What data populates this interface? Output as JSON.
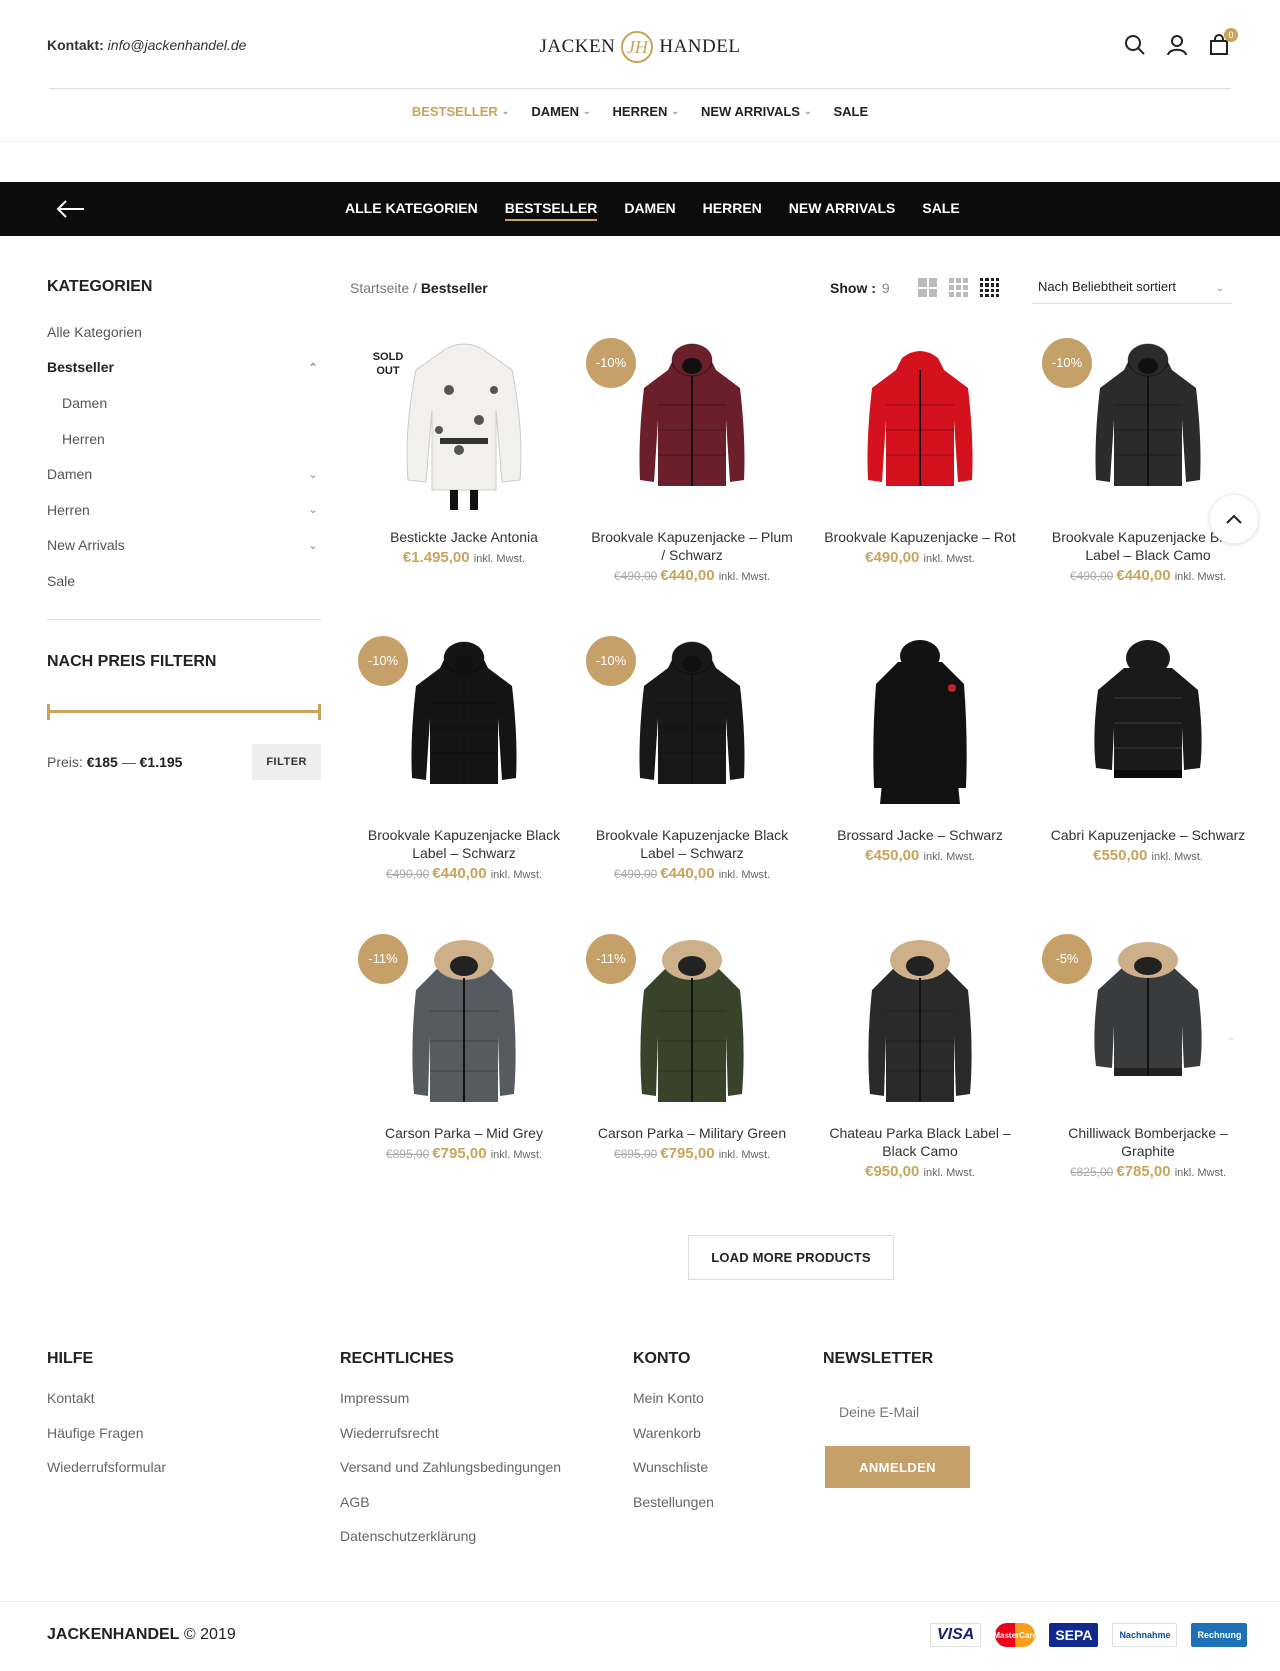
{
  "header": {
    "contact_label": "Kontakt:",
    "contact_email": "info@jackenhandel.de",
    "logo_left": "JACKEN",
    "logo_right": "HANDEL",
    "logo_mark": "JH",
    "cart_count": "0",
    "icons": [
      "search-icon",
      "user-icon",
      "shopping-bag-icon"
    ],
    "nav": [
      {
        "label": "BESTSELLER",
        "active": true,
        "dropdown": true
      },
      {
        "label": "DAMEN",
        "active": false,
        "dropdown": true
      },
      {
        "label": "HERREN",
        "active": false,
        "dropdown": true
      },
      {
        "label": "NEW ARRIVALS",
        "active": false,
        "dropdown": true
      },
      {
        "label": "SALE",
        "active": false,
        "dropdown": false
      }
    ]
  },
  "category_bar": {
    "items": [
      {
        "label": "ALLE KATEGORIEN",
        "active": false
      },
      {
        "label": "BESTSELLER",
        "active": true
      },
      {
        "label": "DAMEN",
        "active": false
      },
      {
        "label": "HERREN",
        "active": false
      },
      {
        "label": "NEW ARRIVALS",
        "active": false
      },
      {
        "label": "SALE",
        "active": false
      }
    ]
  },
  "sidebar": {
    "categories_title": "KATEGORIEN",
    "categories": [
      {
        "label": "Alle Kategorien",
        "level": 0,
        "active": false,
        "arrow": ""
      },
      {
        "label": "Bestseller",
        "level": 0,
        "active": true,
        "arrow": "up"
      },
      {
        "label": "Damen",
        "level": 1,
        "active": false,
        "arrow": ""
      },
      {
        "label": "Herren",
        "level": 1,
        "active": false,
        "arrow": ""
      },
      {
        "label": "Damen",
        "level": 0,
        "active": false,
        "arrow": "down"
      },
      {
        "label": "Herren",
        "level": 0,
        "active": false,
        "arrow": "down"
      },
      {
        "label": "New Arrivals",
        "level": 0,
        "active": false,
        "arrow": "down"
      },
      {
        "label": "Sale",
        "level": 0,
        "active": false,
        "arrow": ""
      }
    ],
    "price_title": "NACH PREIS FILTERN",
    "price_label": "Preis:",
    "price_min": "€185",
    "price_sep": "—",
    "price_max": "€1.195",
    "filter_button": "FILTER"
  },
  "toolbar": {
    "breadcrumb_home": "Startseite",
    "breadcrumb_sep": "/",
    "breadcrumb_current": "Bestseller",
    "show_label": "Show :",
    "show_value": "9",
    "sort_value": "Nach Beliebtheit sortiert"
  },
  "products": [
    {
      "name": "Bestickte Jacke Antonia",
      "old_price": "",
      "price": "€1.495,00",
      "tax": "inkl. Mwst.",
      "badge": "",
      "soldout": "SOLD OUT",
      "img": "white-floral",
      "color": "#f2f0ec"
    },
    {
      "name": "Brookvale Kapuzenjacke – Plum / Schwarz",
      "old_price": "€490,00",
      "price": "€440,00",
      "tax": "inkl. Mwst.",
      "badge": "-10%",
      "soldout": "",
      "img": "puffer-hood",
      "color": "#6b1f2a"
    },
    {
      "name": "Brookvale Kapuzenjacke – Rot",
      "old_price": "",
      "price": "€490,00",
      "tax": "inkl. Mwst.",
      "badge": "",
      "soldout": "",
      "img": "puffer",
      "color": "#d4121d"
    },
    {
      "name": "Brookvale Kapuzenjacke Black Label – Black Camo",
      "old_price": "€490,00",
      "price": "€440,00",
      "tax": "inkl. Mwst.",
      "badge": "-10%",
      "soldout": "",
      "img": "puffer-hood",
      "color": "#2b2b2b"
    },
    {
      "name": "Brookvale Kapuzenjacke Black Label – Schwarz",
      "old_price": "€490,00",
      "price": "€440,00",
      "tax": "inkl. Mwst.",
      "badge": "-10%",
      "soldout": "",
      "img": "puffer-hood",
      "color": "#141414"
    },
    {
      "name": "Brookvale Kapuzenjacke Black Label – Schwarz",
      "old_price": "€490,00",
      "price": "€440,00",
      "tax": "inkl. Mwst.",
      "badge": "-10%",
      "soldout": "",
      "img": "puffer-hood",
      "color": "#181818"
    },
    {
      "name": "Brossard Jacke – Schwarz",
      "old_price": "",
      "price": "€450,00",
      "tax": "inkl. Mwst.",
      "badge": "",
      "soldout": "",
      "img": "coat",
      "color": "#121212"
    },
    {
      "name": "Cabri Kapuzenjacke – Schwarz",
      "old_price": "",
      "price": "€550,00",
      "tax": "inkl. Mwst.",
      "badge": "",
      "soldout": "",
      "img": "bomber-hood",
      "color": "#1a1a1a"
    },
    {
      "name": "Carson Parka – Mid Grey",
      "old_price": "€895,00",
      "price": "€795,00",
      "tax": "inkl. Mwst.",
      "badge": "-11%",
      "soldout": "",
      "img": "parka-fur",
      "color": "#565a61"
    },
    {
      "name": "Carson Parka – Military Green",
      "old_price": "€895,00",
      "price": "€795,00",
      "tax": "inkl. Mwst.",
      "badge": "-11%",
      "soldout": "",
      "img": "parka-fur",
      "color": "#37442a"
    },
    {
      "name": "Chateau Parka Black Label – Black Camo",
      "old_price": "",
      "price": "€950,00",
      "tax": "inkl. Mwst.",
      "badge": "",
      "soldout": "",
      "img": "parka-fur",
      "color": "#2a2a2a"
    },
    {
      "name": "Chilliwack Bomberjacke – Graphite",
      "old_price": "€825,00",
      "price": "€785,00",
      "tax": "inkl. Mwst.",
      "badge": "-5%",
      "soldout": "",
      "img": "bomber-fur",
      "color": "#3a3b3d"
    }
  ],
  "load_more": "LOAD MORE PRODUCTS",
  "footer": {
    "columns": [
      {
        "title": "HILFE",
        "links": [
          "Kontakt",
          "Häufige Fragen",
          "Wiederrufsformular"
        ]
      },
      {
        "title": "RECHTLICHES",
        "links": [
          "Impressum",
          "Wiederrufsrecht",
          "Versand und Zahlungsbedingungen",
          "AGB",
          "Datenschutzerklärung"
        ]
      },
      {
        "title": "KONTO",
        "links": [
          "Mein Konto",
          "Warenkorb",
          "Wunschliste",
          "Bestellungen"
        ]
      }
    ],
    "newsletter_title": "NEWSLETTER",
    "newsletter_placeholder": "Deine E-Mail",
    "newsletter_button": "ANMELDEN",
    "brand": "JACKENHANDEL",
    "copyright": "© 2019",
    "payments": [
      "VISA",
      "MasterCard",
      "SEPA",
      "Nachnahme",
      "Rechnung"
    ]
  },
  "colors": {
    "accent": "#c9a45c",
    "badge": "#c5a068",
    "bar": "#0c0c0c"
  }
}
